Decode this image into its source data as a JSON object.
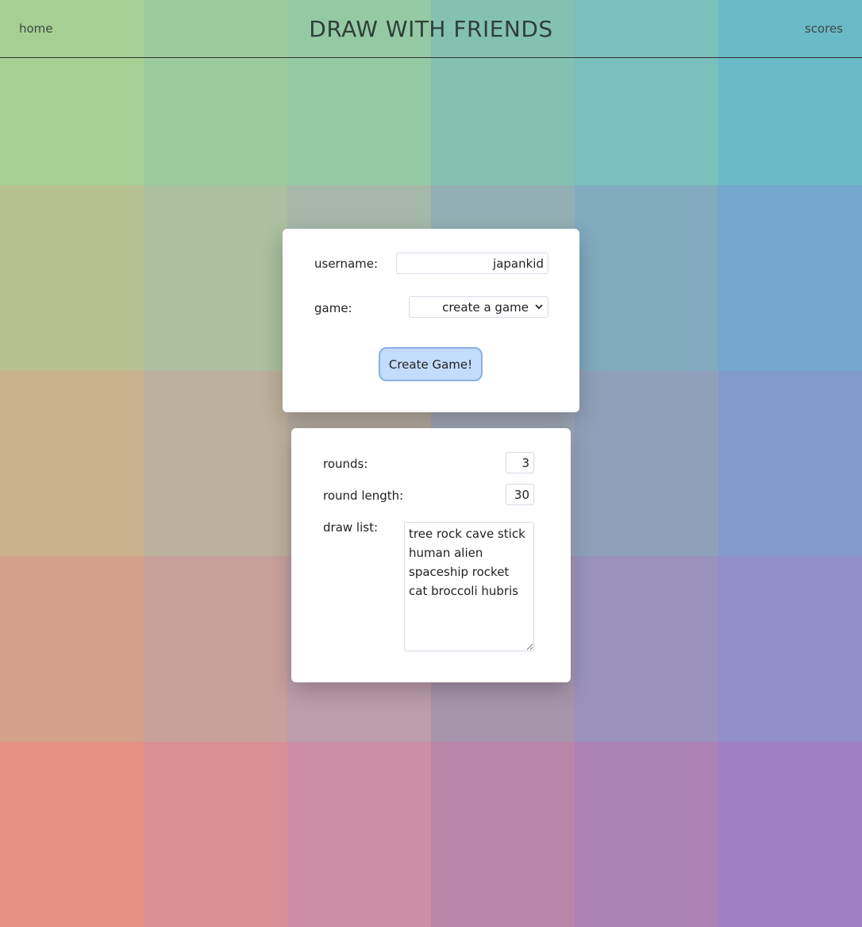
{
  "nav": {
    "home_label": "home",
    "title": "DRAW WITH FRIENDS",
    "scores_label": "scores"
  },
  "join_form": {
    "username_label": "username:",
    "username_value": "japankid",
    "game_label": "game:",
    "game_selected": "create a game",
    "create_button_label": "Create Game!"
  },
  "settings_form": {
    "rounds_label": "rounds:",
    "rounds_value": "3",
    "round_length_label": "round length:",
    "round_length_value": "30",
    "draw_list_label": "draw list:",
    "draw_list_value": "tree rock cave stick human alien spaceship rocket cat broccoli hubris"
  },
  "background": {
    "rows": [
      [
        "#a6cf93",
        "#9ccc9e",
        "#94c9a4",
        "#85c1b1",
        "#79c0bd",
        "#6bbac8"
      ],
      [
        "#b8c192",
        "#acbf9e",
        "#a5b8aa",
        "#92b0b3",
        "#82abbf",
        "#74a8cc"
      ],
      [
        "#c8b28c",
        "#bdb09c",
        "#b4aa9f",
        "#9ea6b4",
        "#8fa1ba",
        "#839bcb"
      ],
      [
        "#d4a28a",
        "#c8a09c",
        "#bc9daa",
        "#a696ab",
        "#9a92bd",
        "#918ec9"
      ],
      [
        "#e59284",
        "#da8f96",
        "#cd8ea5",
        "#b986a9",
        "#ac82b5",
        "#a080c4"
      ]
    ],
    "accent_button": "#c2dcfb",
    "accent_button_border": "#8ab0e6"
  }
}
